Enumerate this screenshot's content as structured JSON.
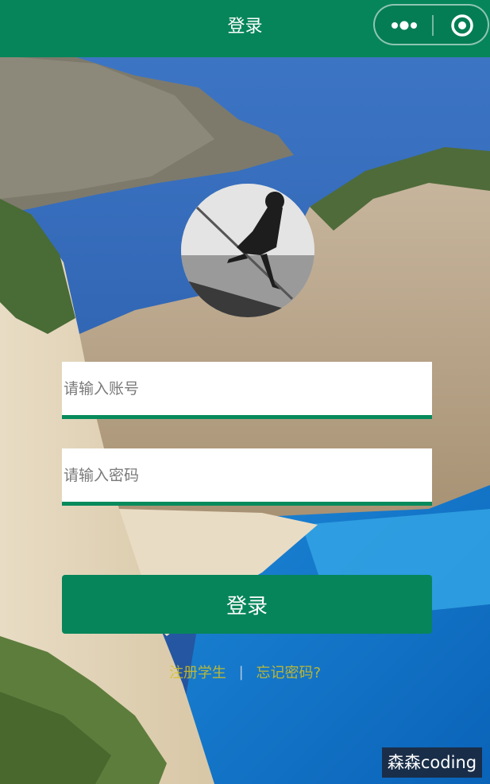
{
  "navbar": {
    "title": "登录",
    "bg_color": "#06855a",
    "capsule": {
      "more_icon": "more-dots-icon",
      "close_icon": "target-close-icon"
    }
  },
  "avatar": {
    "icon": "avatar-photo"
  },
  "form": {
    "account": {
      "placeholder": "请输入账号",
      "value": ""
    },
    "password": {
      "placeholder": "请输入密码",
      "value": ""
    },
    "login_label": "登录"
  },
  "links": {
    "register": "注册学生",
    "separator": "|",
    "forgot": "忘记密码?"
  },
  "watermark": "森森coding",
  "colors": {
    "accent": "#06855a",
    "link": "#d6c21e",
    "input_border": "#078a5c"
  }
}
